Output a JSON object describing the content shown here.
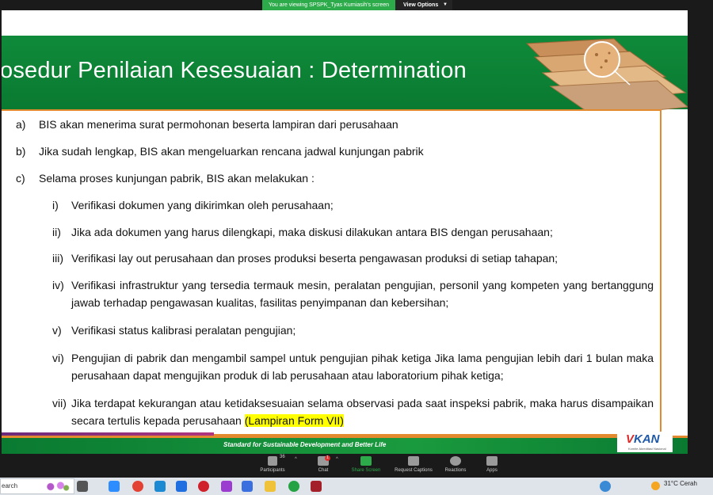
{
  "zoom": {
    "viewing_text": "You are viewing SPSPK_Tyas Kurniasih's screen",
    "view_options": "View Options",
    "toolbar": [
      {
        "label": "Participants",
        "icon": "participants-icon",
        "count": "36"
      },
      {
        "label": "Chat",
        "icon": "chat-icon",
        "badge": "1"
      },
      {
        "label": "Share Screen",
        "icon": "share-screen-icon"
      },
      {
        "label": "Request Captions",
        "icon": "captions-icon"
      },
      {
        "label": "Reactions",
        "icon": "reactions-icon"
      },
      {
        "label": "Apps",
        "icon": "apps-icon"
      }
    ]
  },
  "slide": {
    "title": "osedur Penilaian Kesesuaian : Determination",
    "items": [
      {
        "marker": "a)",
        "text": "BIS akan menerima surat permohonan beserta lampiran dari perusahaan"
      },
      {
        "marker": "b)",
        "text": "Jika sudah lengkap, BIS akan mengeluarkan rencana jadwal kunjungan pabrik"
      },
      {
        "marker": "c)",
        "text": "Selama proses kunjungan pabrik, BIS akan melakukan :"
      }
    ],
    "subitems": [
      {
        "marker": "i)",
        "text": "Verifikasi dokumen yang dikirimkan oleh perusahaan;"
      },
      {
        "marker": "ii)",
        "text": "Jika ada dokumen yang harus dilengkapi, maka diskusi dilakukan antara BIS dengan perusahaan;"
      },
      {
        "marker": "iii)",
        "text": "Verifikasi lay out perusahaan dan proses produksi beserta pengawasan produksi di setiap tahapan;"
      },
      {
        "marker": "iv)",
        "text": "Verifikasi infrastruktur yang tersedia termauk mesin, peralatan pengujian, personil yang kompeten yang bertanggung jawab terhadap pengawasan kualitas, fasilitas penyimpanan dan kebersihan;"
      },
      {
        "marker": "v)",
        "text": "Verifikasi status kalibrasi peralatan pengujian;"
      },
      {
        "marker": "vi)",
        "text": "Pengujian di pabrik dan mengambil sampel untuk pengujian pihak ketiga Jika lama pengujian lebih dari 1 bulan maka perusahaan dapat mengujikan produk di lab perusahaan atau laboratorium pihak ketiga;"
      },
      {
        "marker": "vii)",
        "text": "Jika terdapat kekurangan atau ketidaksesuaian selama observasi pada saat inspeksi pabrik, maka harus disampaikan secara tertulis kepada perusahaan",
        "highlight": "(Lampiran Form VII)"
      }
    ],
    "footer_slogan": "Standard for Sustainable Development and Better Life",
    "logo_text": "KAN",
    "logo_subtitle": "Komite Akreditasi Nasional"
  },
  "taskbar": {
    "search_text": "earch",
    "weather": "31°C  Cerah",
    "icons": [
      "task-view-icon",
      "zoom-app-icon",
      "chrome-icon",
      "vscode-icon",
      "dropbox-icon",
      "opera-icon",
      "app-icon",
      "media-icon",
      "file-explorer-icon",
      "whatsapp-icon",
      "app-red-icon",
      "help-icon"
    ]
  }
}
